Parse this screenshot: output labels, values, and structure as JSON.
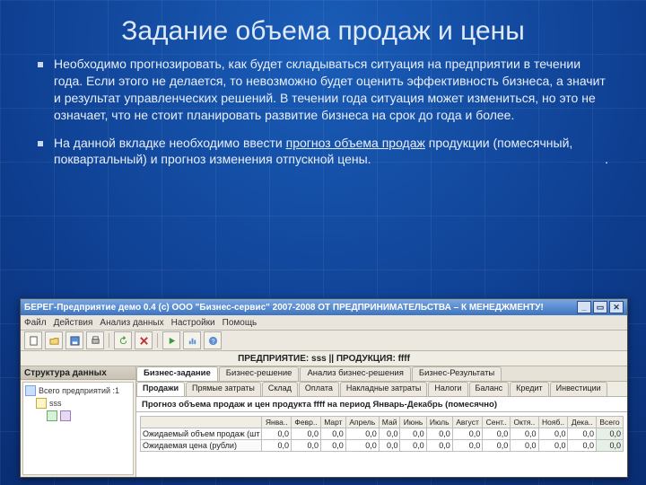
{
  "slide": {
    "title": "Задание объема продаж и цены",
    "para1": "Необходимо прогнозировать, как будет складываться ситуация на предприятии в течении года. Если этого не делается, то невозможно будет оценить эффективность бизнеса, а значит и результат управленческих решений. В течении года ситуация может измениться, но это не означает, что не стоит планировать развитие бизнеса на срок до года и более.",
    "para2_a": "На данной вкладке необходимо ввести ",
    "para2_u": "прогноз объема продаж",
    "para2_b": " продукции (помесячный, поквартальный) и прогноз изменения отпускной цены.",
    "dot": "."
  },
  "app": {
    "title": "БЕРЕГ-Предприятие демо 0.4   (с) ООО \"Бизнес-сервис\" 2007-2008   ОТ ПРЕДПРИНИМАТЕЛЬСТВА – К МЕНЕДЖМЕНТУ!",
    "menu": [
      "Файл",
      "Действия",
      "Анализ данных",
      "Настройки",
      "Помощь"
    ],
    "wbtn_min": "_",
    "wbtn_max": "▭",
    "wbtn_close": "✕",
    "info": "ПРЕДПРИЯТИЕ: sss  ||  ПРОДУКЦИЯ: ffff",
    "side_header": "Структура данных",
    "tree_total": "Всего предприятий :1",
    "tree_item": "sss",
    "tabs1": [
      "Бизнес-задание",
      "Бизнес-решение",
      "Анализ бизнес-решения",
      "Бизнес-Результаты"
    ],
    "tabs1_active": 0,
    "tabs2": [
      "Продажи",
      "Прямые затраты",
      "Склад",
      "Оплата",
      "Накладные затраты",
      "Налоги",
      "Баланс",
      "Кредит",
      "Инвестиции"
    ],
    "tabs2_active": 0,
    "caption": "Прогноз объема продаж и цен продукта ffff на период Январь-Декабрь (помесячно)",
    "months": [
      "Янва..",
      "Февр..",
      "Март",
      "Апрель",
      "Май",
      "Июнь",
      "Июль",
      "Август",
      "Сент..",
      "Октя..",
      "Нояб..",
      "Дека..",
      "Всего"
    ],
    "rows": [
      {
        "label": "Ожидаемый объем продаж (шт",
        "vals": [
          "0,0",
          "0,0",
          "0,0",
          "0,0",
          "0,0",
          "0,0",
          "0,0",
          "0,0",
          "0,0",
          "0,0",
          "0,0",
          "0,0",
          "0,0"
        ]
      },
      {
        "label": "Ожидаемая цена (рубли)",
        "vals": [
          "0,0",
          "0,0",
          "0,0",
          "0,0",
          "0,0",
          "0,0",
          "0,0",
          "0,0",
          "0,0",
          "0,0",
          "0,0",
          "0,0",
          "0,0"
        ]
      }
    ],
    "toolbar_icons": [
      "doc-icon",
      "open-icon",
      "save-icon",
      "print-icon",
      "refresh-icon",
      "delete-icon",
      "run-icon",
      "chart-icon",
      "help-icon"
    ]
  }
}
